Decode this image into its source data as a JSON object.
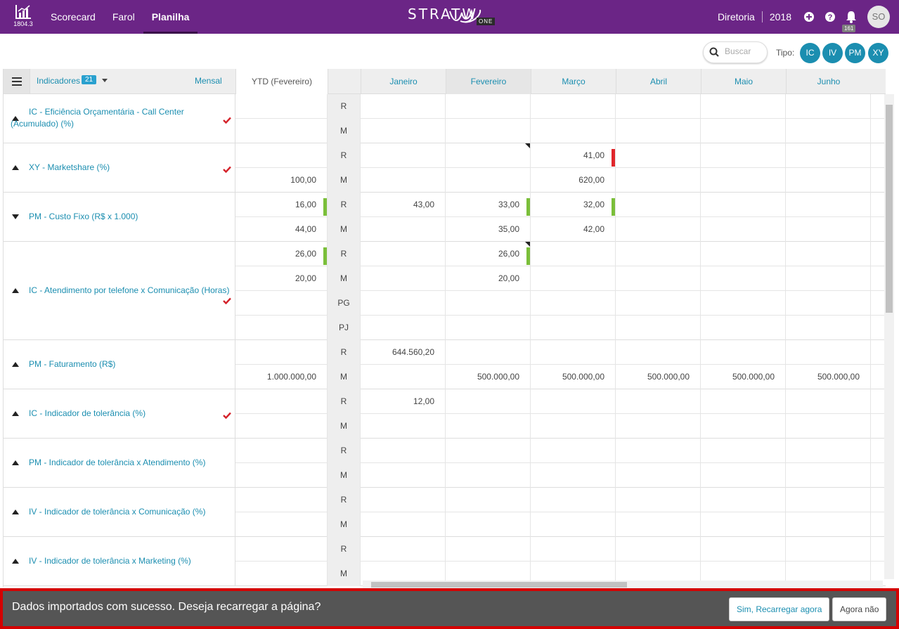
{
  "topbar": {
    "version": "1804.3",
    "nav": [
      "Scorecard",
      "Farol",
      "Planilha"
    ],
    "brand": "STRATW",
    "brand_badge": "ONE",
    "org": "Diretoria",
    "year": "2018",
    "notifications_count": "161",
    "avatar": "SO"
  },
  "toolbar": {
    "search_placeholder": "Buscar",
    "tipo_label": "Tipo:",
    "tipos": [
      "IC",
      "IV",
      "PM",
      "XY"
    ]
  },
  "grid": {
    "indicadores_label": "Indicadores",
    "indicadores_count": "21",
    "periodicity": "Mensal",
    "ytd_header": "YTD (Fevereiro)",
    "months": [
      "Janeiro",
      "Fevereiro",
      "Março",
      "Abril",
      "Maio",
      "Junho"
    ],
    "indicators": [
      {
        "name": "IC - Eficiência Orçamentária - Call Center (Acumulado) (%)",
        "arrow": "up",
        "check": true,
        "rows": [
          {
            "type": "R",
            "ytd": "",
            "m": [
              "",
              "",
              "",
              "",
              "",
              ""
            ]
          },
          {
            "type": "M",
            "ytd": "",
            "m": [
              "",
              "",
              "",
              "",
              "",
              ""
            ]
          }
        ]
      },
      {
        "name": "XY - Marketshare (%)",
        "arrow": "up",
        "check": true,
        "rows": [
          {
            "type": "R",
            "ytd": "",
            "m": [
              "",
              "",
              "41,00",
              "",
              "",
              ""
            ]
          },
          {
            "type": "M",
            "ytd": "100,00",
            "m": [
              "",
              "",
              "620,00",
              "",
              "",
              ""
            ]
          }
        ]
      },
      {
        "name": "PM - Custo Fixo (R$ x 1.000)",
        "arrow": "down",
        "check": false,
        "rows": [
          {
            "type": "R",
            "ytd": "16,00",
            "m": [
              "43,00",
              "33,00",
              "32,00",
              "",
              "",
              ""
            ]
          },
          {
            "type": "M",
            "ytd": "44,00",
            "m": [
              "",
              "35,00",
              "42,00",
              "",
              "",
              ""
            ]
          }
        ]
      },
      {
        "name": "IC - Atendimento por telefone x Comunicação (Horas)",
        "arrow": "up",
        "check": true,
        "rows": [
          {
            "type": "R",
            "ytd": "26,00",
            "m": [
              "",
              "26,00",
              "",
              "",
              "",
              ""
            ]
          },
          {
            "type": "M",
            "ytd": "20,00",
            "m": [
              "",
              "20,00",
              "",
              "",
              "",
              ""
            ]
          },
          {
            "type": "PG",
            "ytd": "",
            "m": [
              "",
              "",
              "",
              "",
              "",
              ""
            ]
          },
          {
            "type": "PJ",
            "ytd": "",
            "m": [
              "",
              "",
              "",
              "",
              "",
              ""
            ]
          }
        ]
      },
      {
        "name": "PM - Faturamento (R$)",
        "arrow": "up",
        "check": false,
        "rows": [
          {
            "type": "R",
            "ytd": "",
            "m": [
              "644.560,20",
              "",
              "",
              "",
              "",
              ""
            ]
          },
          {
            "type": "M",
            "ytd": "1.000.000,00",
            "m": [
              "",
              "500.000,00",
              "500.000,00",
              "500.000,00",
              "500.000,00",
              "500.000,00"
            ]
          }
        ]
      },
      {
        "name": "IC - Indicador de tolerância (%)",
        "arrow": "up",
        "check": true,
        "rows": [
          {
            "type": "R",
            "ytd": "",
            "m": [
              "12,00",
              "",
              "",
              "",
              "",
              ""
            ]
          },
          {
            "type": "M",
            "ytd": "",
            "m": [
              "",
              "",
              "",
              "",
              "",
              ""
            ]
          }
        ]
      },
      {
        "name": "PM - Indicador de tolerância x Atendimento (%)",
        "arrow": "up",
        "check": false,
        "rows": [
          {
            "type": "R",
            "ytd": "",
            "m": [
              "",
              "",
              "",
              "",
              "",
              ""
            ]
          },
          {
            "type": "M",
            "ytd": "",
            "m": [
              "",
              "",
              "",
              "",
              "",
              ""
            ]
          }
        ]
      },
      {
        "name": "IV - Indicador de tolerância x Comunicação (%)",
        "arrow": "up",
        "check": false,
        "rows": [
          {
            "type": "R",
            "ytd": "",
            "m": [
              "",
              "",
              "",
              "",
              "",
              ""
            ]
          },
          {
            "type": "M",
            "ytd": "",
            "m": [
              "",
              "",
              "",
              "",
              "",
              ""
            ]
          }
        ]
      },
      {
        "name": "IV - Indicador de tolerância x Marketing (%)",
        "arrow": "up",
        "check": false,
        "rows": [
          {
            "type": "R",
            "ytd": "",
            "m": [
              "",
              "",
              "",
              "",
              "",
              ""
            ]
          },
          {
            "type": "M",
            "ytd": "",
            "m": [
              "",
              "",
              "",
              "",
              "",
              ""
            ]
          }
        ]
      }
    ]
  },
  "status_colors": {
    "green": "#7bbf3a",
    "red": "#e0262b"
  },
  "notification": {
    "message": "Dados importados com sucesso. Deseja recarregar a página?",
    "reload_button": "Sim, Recarregar agora",
    "dismiss_button": "Agora não"
  }
}
